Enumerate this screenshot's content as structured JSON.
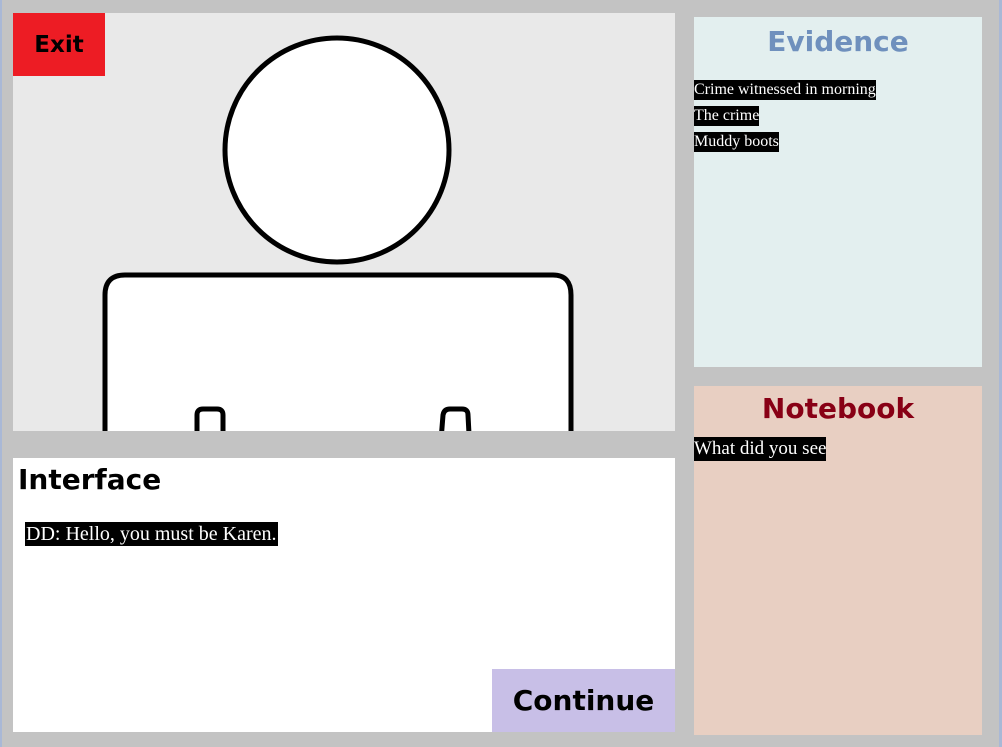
{
  "scene": {
    "exit_label": "Exit"
  },
  "interface": {
    "title": "Interface",
    "dialogue": "DD: Hello, you must be Karen.",
    "continue_label": "Continue"
  },
  "evidence": {
    "title": "Evidence",
    "items": [
      "Crime witnessed in morning",
      "The crime",
      "Muddy boots"
    ]
  },
  "notebook": {
    "title": "Notebook",
    "entries": [
      "What did you see"
    ]
  },
  "colors": {
    "background": "#c3c3c3",
    "scene_bg": "#e9e9e9",
    "exit_button": "#ed1c24",
    "continue_button": "#c8bfe7",
    "evidence_bg": "#e3efef",
    "evidence_title": "#6f90bd",
    "notebook_bg": "#e8cfc2",
    "notebook_title": "#880015"
  }
}
